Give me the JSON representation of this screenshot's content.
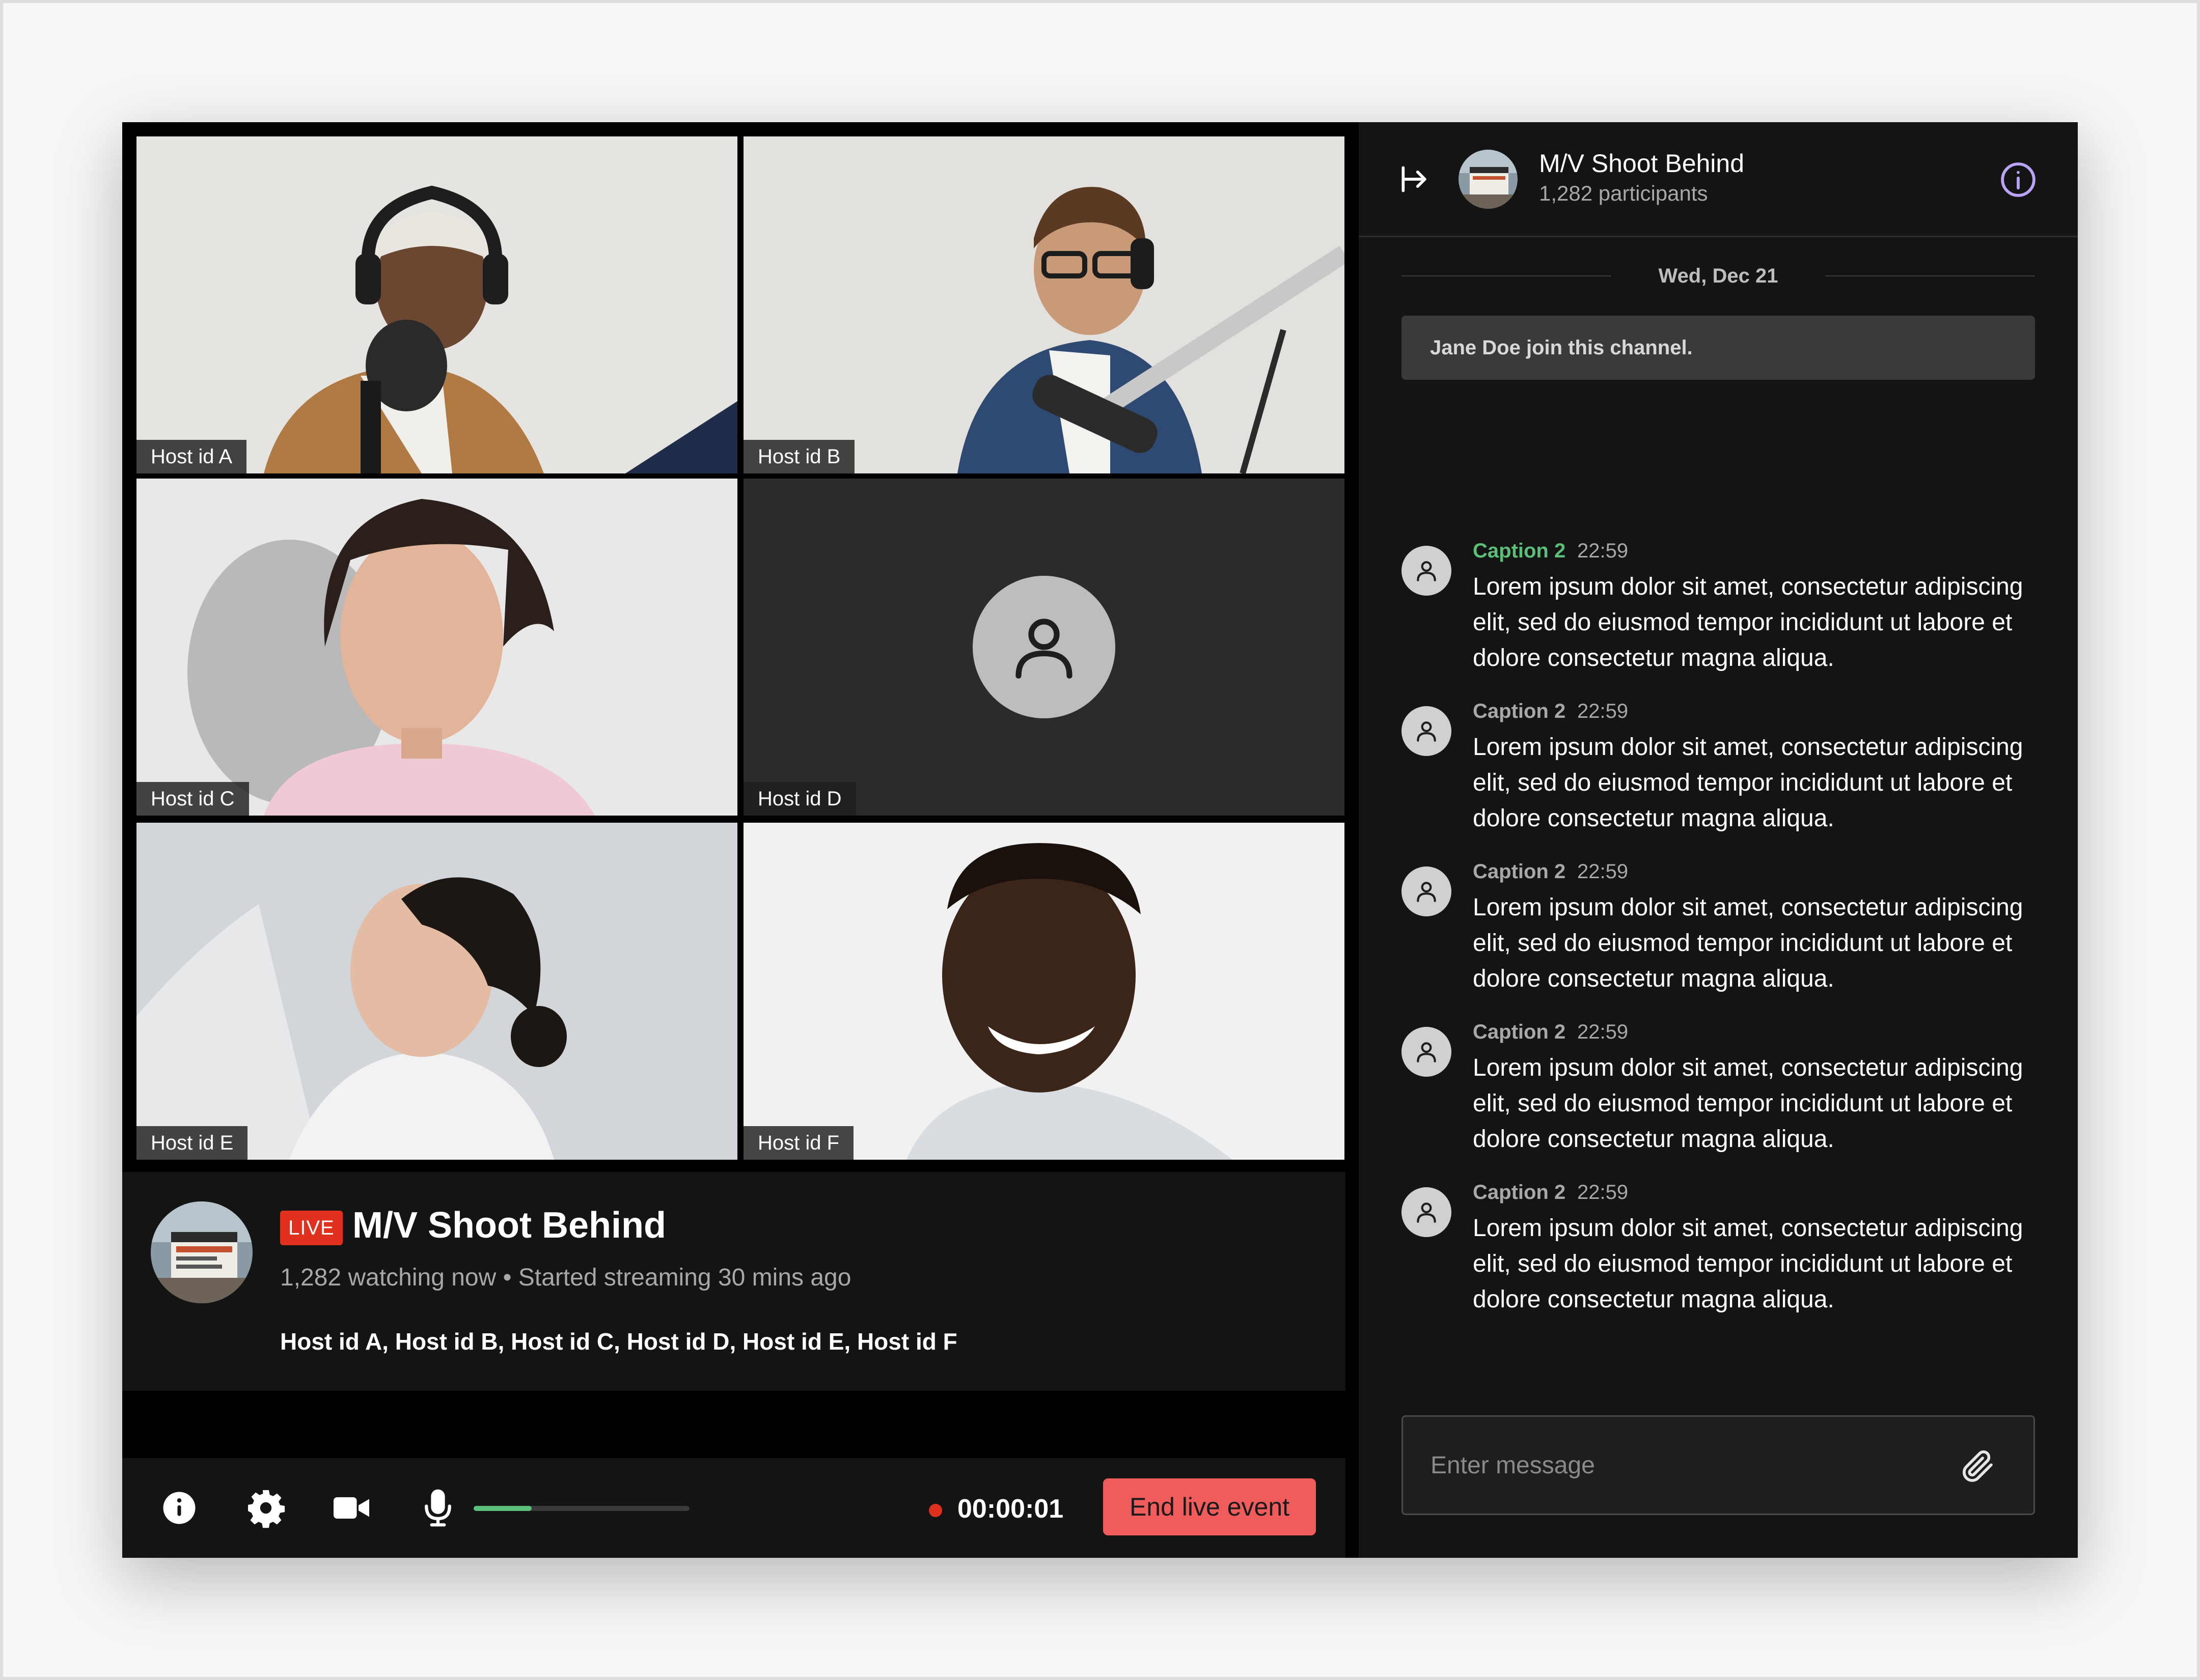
{
  "stream": {
    "title": "M/V Shoot Behind",
    "live_label": "LIVE",
    "meta": "1,282 watching now • Started streaming 30 mins ago",
    "hosts_line": "Host id A, Host id B, Host id C, Host id D, Host id E, Host id F"
  },
  "tiles": [
    {
      "label": "Host id A",
      "has_video": true
    },
    {
      "label": "Host id B",
      "has_video": true
    },
    {
      "label": "Host id C",
      "has_video": true
    },
    {
      "label": "Host id D",
      "has_video": false
    },
    {
      "label": "Host id E",
      "has_video": true
    },
    {
      "label": "Host id F",
      "has_video": true
    }
  ],
  "controls": {
    "icons": [
      "info-icon",
      "settings-gear-icon",
      "camera-icon",
      "microphone-icon"
    ],
    "mic_level": 0.27,
    "timer": "00:00:01",
    "end_label": "End live event"
  },
  "chat": {
    "channel_title": "M/V Shoot Behind",
    "participants": "1,282 participants",
    "date_divider": "Wed, Dec 21",
    "system_message": "Jane Doe join this channel.",
    "messages": [
      {
        "author": "Caption 2",
        "time": "22:59",
        "highlight": true,
        "text": "Lorem ipsum dolor sit amet, consectetur adipiscing elit, sed do eiusmod tempor incididunt ut labore et dolore consectetur magna aliqua."
      },
      {
        "author": "Caption 2",
        "time": "22:59",
        "highlight": false,
        "text": "Lorem ipsum dolor sit amet, consectetur adipiscing elit, sed do eiusmod tempor incididunt ut labore et dolore consectetur magna aliqua."
      },
      {
        "author": "Caption 2",
        "time": "22:59",
        "highlight": false,
        "text": "Lorem ipsum dolor sit amet, consectetur adipiscing elit, sed do eiusmod tempor incididunt ut labore et dolore consectetur magna aliqua."
      },
      {
        "author": "Caption 2",
        "time": "22:59",
        "highlight": false,
        "text": "Lorem ipsum dolor sit amet, consectetur adipiscing elit, sed do eiusmod tempor incididunt ut labore et dolore consectetur magna aliqua."
      },
      {
        "author": "Caption 2",
        "time": "22:59",
        "highlight": false,
        "text": "Lorem ipsum dolor sit amet, consectetur adipiscing elit, sed do eiusmod tempor incididunt ut labore et dolore consectetur magna aliqua."
      }
    ],
    "composer_placeholder": "Enter message"
  },
  "colors": {
    "accent_live": "#e0301e",
    "accent_green": "#5bbf7a",
    "end_button": "#f05b5b",
    "info_purple": "#b9a4f5"
  }
}
